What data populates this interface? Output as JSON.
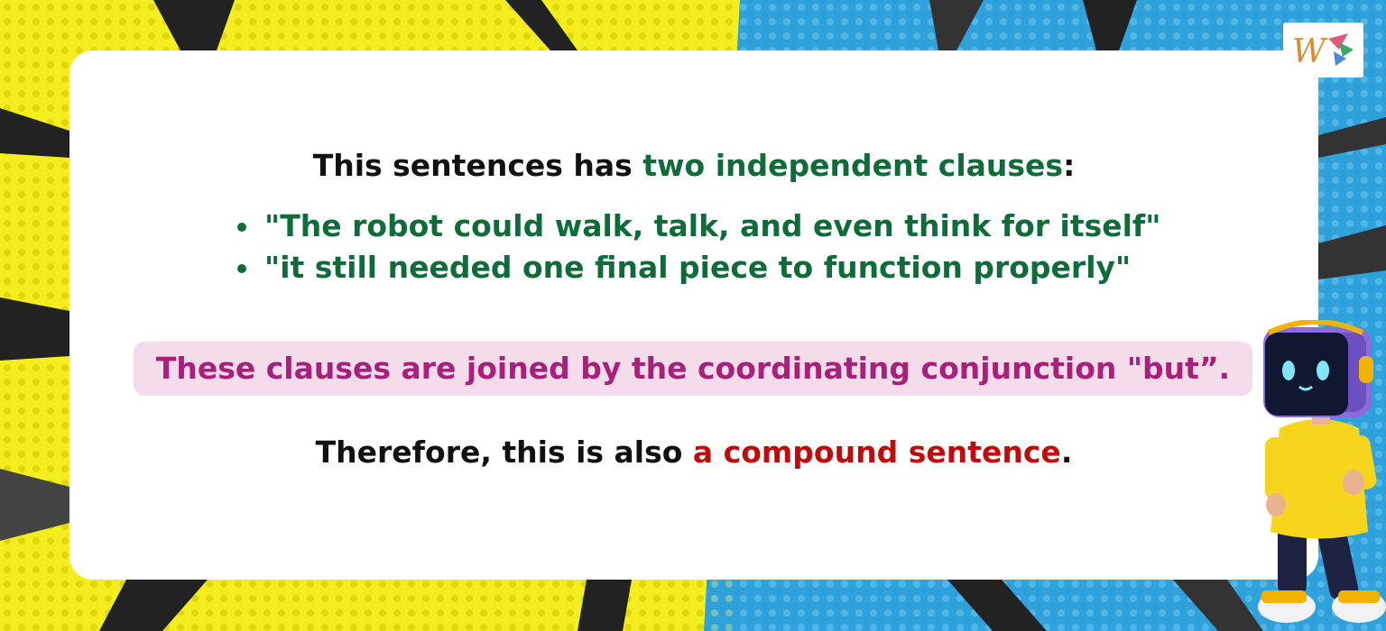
{
  "slide": {
    "headline": {
      "prefix": "This sentences has ",
      "highlight": "two independent clauses",
      "suffix": ":"
    },
    "bullets": [
      "\"The robot could walk, talk, and even think for itself\"",
      "\"it still needed one final piece to function properly\""
    ],
    "highlight_box": "These clauses are joined by the coordinating conjunction \"but”.",
    "conclusion": {
      "prefix": "Therefore, this is also ",
      "highlight": "a compound sentence",
      "suffix": "."
    }
  },
  "colors": {
    "green": "#0e6b3a",
    "magenta": "#a8207a",
    "highlight_bg": "#f4dcea",
    "red": "#c00b0b",
    "bg_yellow": "#f4ee1e",
    "bg_blue": "#2fa2dc"
  },
  "icons": {
    "logo": "w-logo-icon",
    "mascot": "robot-mascot-icon"
  }
}
